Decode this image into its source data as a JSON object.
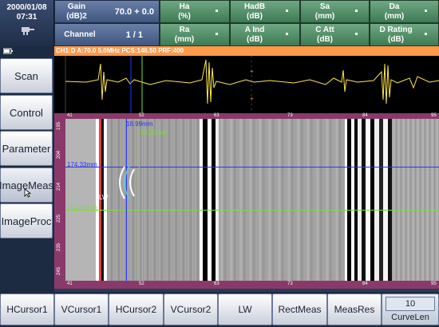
{
  "header": {
    "date": "2000/01/08",
    "time": "07:31",
    "gain_label": "Gain\n(dB)2",
    "gain_value": "70.0 + 0.0",
    "channel_label": "Channel",
    "channel_value": "1 / 1",
    "cells_top": [
      {
        "label": "Ha\n(%)"
      },
      {
        "label": "HadB\n(dB)"
      },
      {
        "label": "Sa\n(mm)"
      },
      {
        "label": "Da\n(mm)"
      }
    ],
    "cells_bottom": [
      {
        "label": "Ra\n(mm)"
      },
      {
        "label": "A Ind\n(dB)"
      },
      {
        "label": "C Att\n(dB)"
      },
      {
        "label": "D Rating\n(dB)"
      }
    ]
  },
  "status": "CH1:D A:70.0 5.0MHz PCS:146.50 PRF:400",
  "sidebar": {
    "items": [
      "Scan",
      "Control",
      "Parameter",
      "ImageMeas",
      "ImageProc"
    ],
    "active": "ImageMeas"
  },
  "bottom_buttons": [
    "HCursor1",
    "VCursor1",
    "HCursor2",
    "VCursor2",
    "LW",
    "RectMeas",
    "MeasRes"
  ],
  "curvelen": {
    "value": "10",
    "label": "CurveLen"
  },
  "image": {
    "h1_label": "174.33mm",
    "h2_label": "204.16mm",
    "v1_label": "18.99mm",
    "v2_label": "24.35mm",
    "lw_label": "LW",
    "ruler_ticks": [
      "41",
      "52",
      "63",
      "73",
      "84",
      "95"
    ],
    "v_ticks": [
      "195",
      "204",
      "214",
      "225",
      "235",
      "245"
    ]
  },
  "colors": {
    "status_bar": "#ff9a4a",
    "ruler": "#8a3a6a",
    "cursor_blue": "#2a35ff",
    "cursor_green": "#7ddc3a"
  }
}
